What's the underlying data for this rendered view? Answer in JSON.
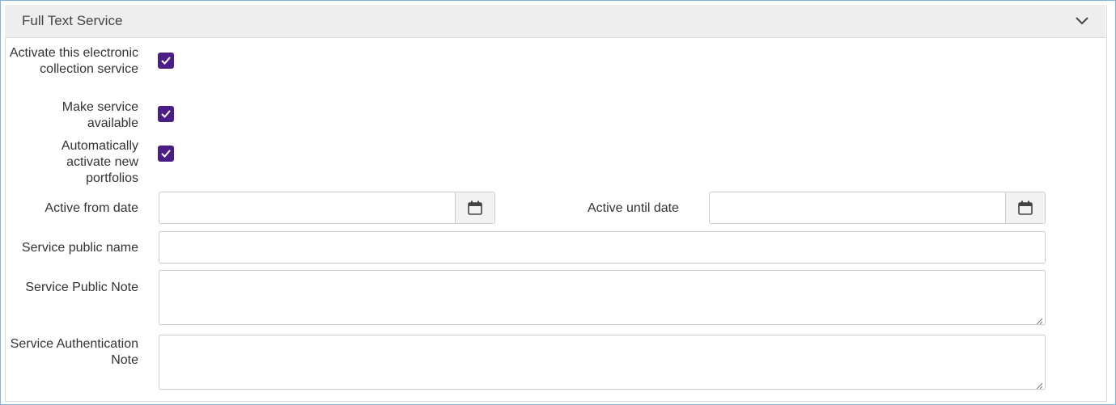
{
  "panel": {
    "title": "Full Text Service",
    "collapse_icon": "chevron-down-icon"
  },
  "fields": {
    "activate_label": "Activate this electronic collection service",
    "activate_checked": true,
    "available_label": "Make service available",
    "available_checked": true,
    "auto_activate_label": "Automatically activate new portfolios",
    "auto_activate_checked": true,
    "active_from_label": "Active from date",
    "active_from_value": "",
    "active_until_label": "Active until date",
    "active_until_value": "",
    "public_name_label": "Service public name",
    "public_name_value": "",
    "public_note_label": "Service Public Note",
    "public_note_value": "",
    "auth_note_label": "Service Authentication Note",
    "auth_note_value": "",
    "calendar_icon": "calendar-icon"
  },
  "colors": {
    "checkbox": "#4b1e86",
    "border_accent": "#7fb2e6",
    "header_bg": "#eeeeee"
  }
}
